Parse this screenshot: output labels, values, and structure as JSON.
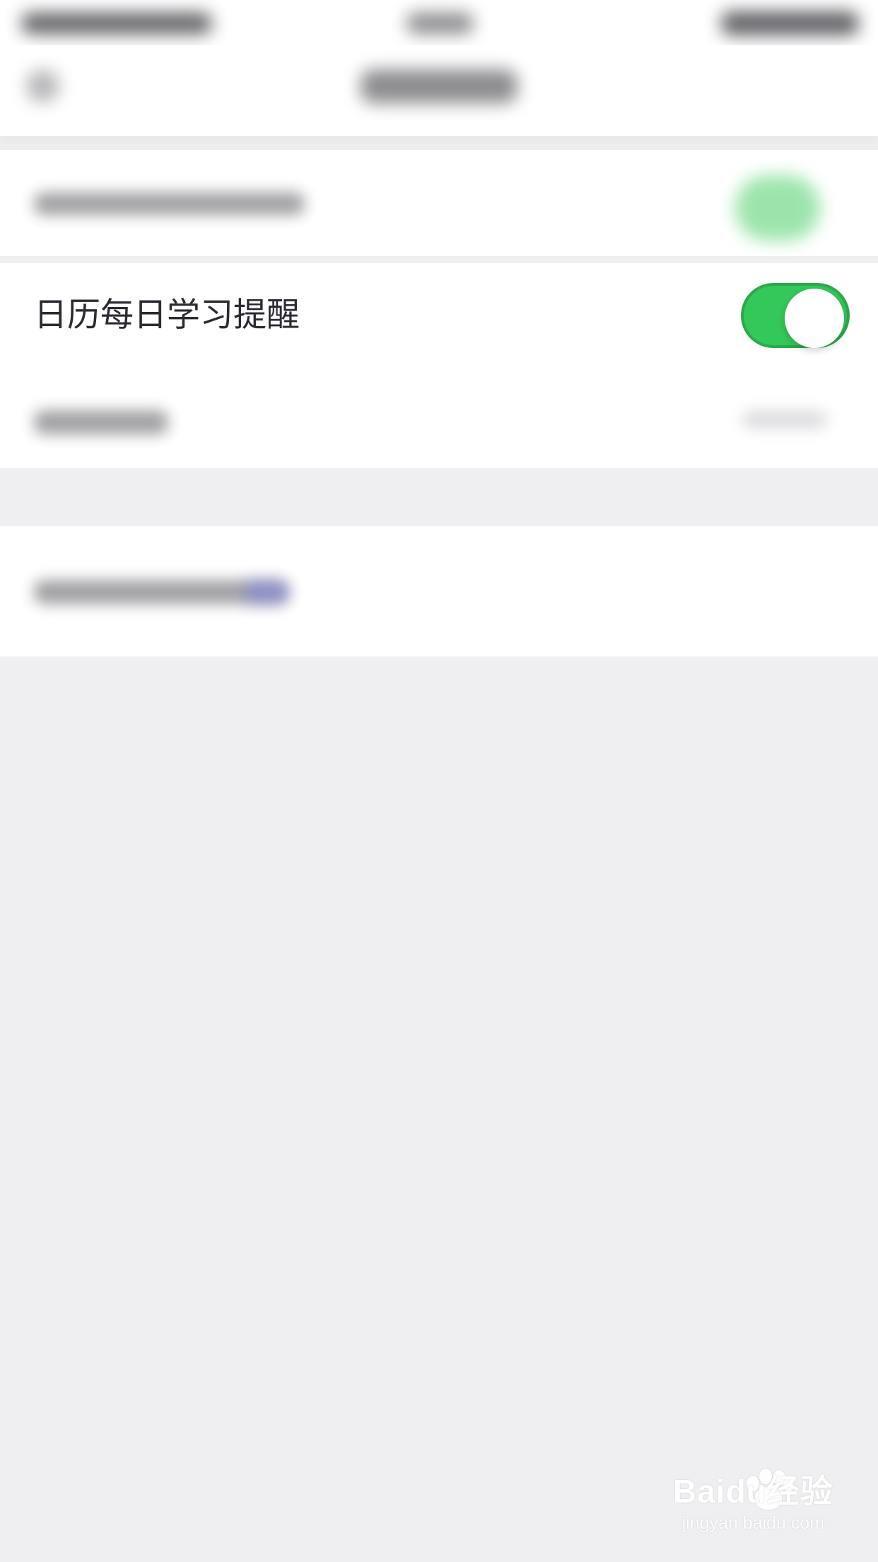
{
  "settings": {
    "daily_study_reminder": {
      "label": "日历每日学习提醒",
      "enabled": true
    }
  },
  "colors": {
    "toggle_on": "#34c759",
    "text": "#2b2b33",
    "background": "#efeff2"
  },
  "watermark": {
    "title": "Baidu经验",
    "url": "jingyan.baidu.com"
  }
}
